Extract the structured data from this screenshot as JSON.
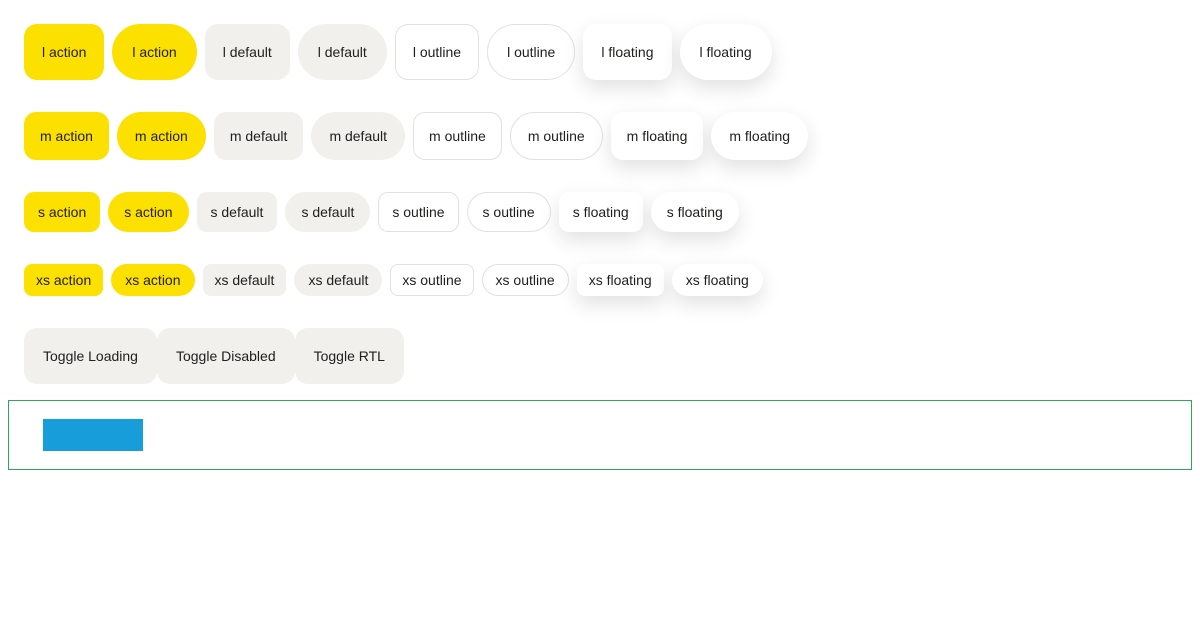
{
  "rows": {
    "l": [
      "l action",
      "l action",
      "l default",
      "l default",
      "l outline",
      "l outline",
      "l floating",
      "l floating"
    ],
    "m": [
      "m action",
      "m action",
      "m default",
      "m default",
      "m outline",
      "m outline",
      "m floating",
      "m floating"
    ],
    "s": [
      "s action",
      "s action",
      "s default",
      "s default",
      "s outline",
      "s outline",
      "s floating",
      "s floating"
    ],
    "xs": [
      "xs action",
      "xs action",
      "xs default",
      "xs default",
      "xs outline",
      "xs outline",
      "xs floating",
      "xs floating"
    ]
  },
  "toggles": {
    "loading": "Toggle Loading",
    "disabled": "Toggle Disabled",
    "rtl": "Toggle RTL"
  },
  "colors": {
    "action": "#fce000",
    "default": "#f1f0ed",
    "outline_border": "#e2e1de",
    "frame_border": "#2fa65a",
    "test_block": "#189ddb"
  }
}
